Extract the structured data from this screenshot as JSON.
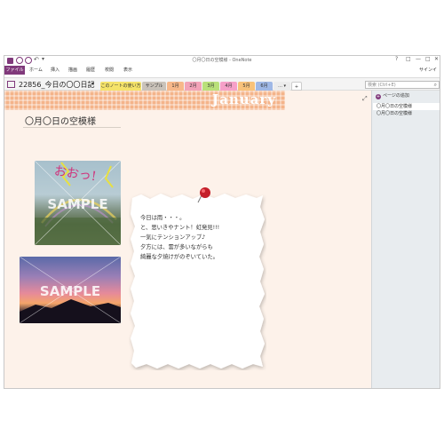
{
  "window": {
    "title": "〇月〇日の空模様 - OneNote",
    "controls": [
      "?",
      "□",
      "—",
      "□",
      "✕"
    ],
    "signin": "サインイ"
  },
  "ribbon": {
    "file": "ファイル",
    "tabs": [
      "ホーム",
      "挿入",
      "描画",
      "履歴",
      "校閲",
      "表示"
    ]
  },
  "notebook": {
    "name": "22856_今日の〇〇日記",
    "sections": [
      {
        "label": "このノートの使い方",
        "color": "#f5e36a"
      },
      {
        "label": "サンプル",
        "color": "#c9c2b9"
      },
      {
        "label": "1月",
        "color": "#f7b88a"
      },
      {
        "label": "2月",
        "color": "#f2a3b8"
      },
      {
        "label": "3月",
        "color": "#b9e07a"
      },
      {
        "label": "4月",
        "color": "#f6a0c8"
      },
      {
        "label": "5月",
        "color": "#f8c27a"
      },
      {
        "label": "6月",
        "color": "#9fb8e6"
      },
      {
        "label": "… ▾",
        "color": "#ececec"
      },
      {
        "label": "+",
        "color": "#ffffff"
      }
    ],
    "search_placeholder": "検索 (Ctrl+E)"
  },
  "page": {
    "banner": "January",
    "title": "〇月〇日の空模様",
    "photos": [
      {
        "watermark": "SAMPLE",
        "handwriting": "おおっ!"
      },
      {
        "watermark": "SAMPLE"
      }
    ],
    "note_lines": [
      "今日は雨・・・。",
      "と、思いきやナント！虹発見!!!",
      "一気にテンションアップ♪",
      "夕方には、雲が多いながらも",
      "綺麗な夕焼けがのぞいていた。"
    ]
  },
  "pane": {
    "add_page": "ページの追加",
    "pages": [
      {
        "label": "〇月〇日の空模様",
        "selected": true
      },
      {
        "label": "〇月〇日の空模様",
        "selected": false
      }
    ]
  },
  "colors": {
    "accent": "#80397b",
    "page_bg": "#fdf2ea",
    "banner": "#f4b48a"
  }
}
